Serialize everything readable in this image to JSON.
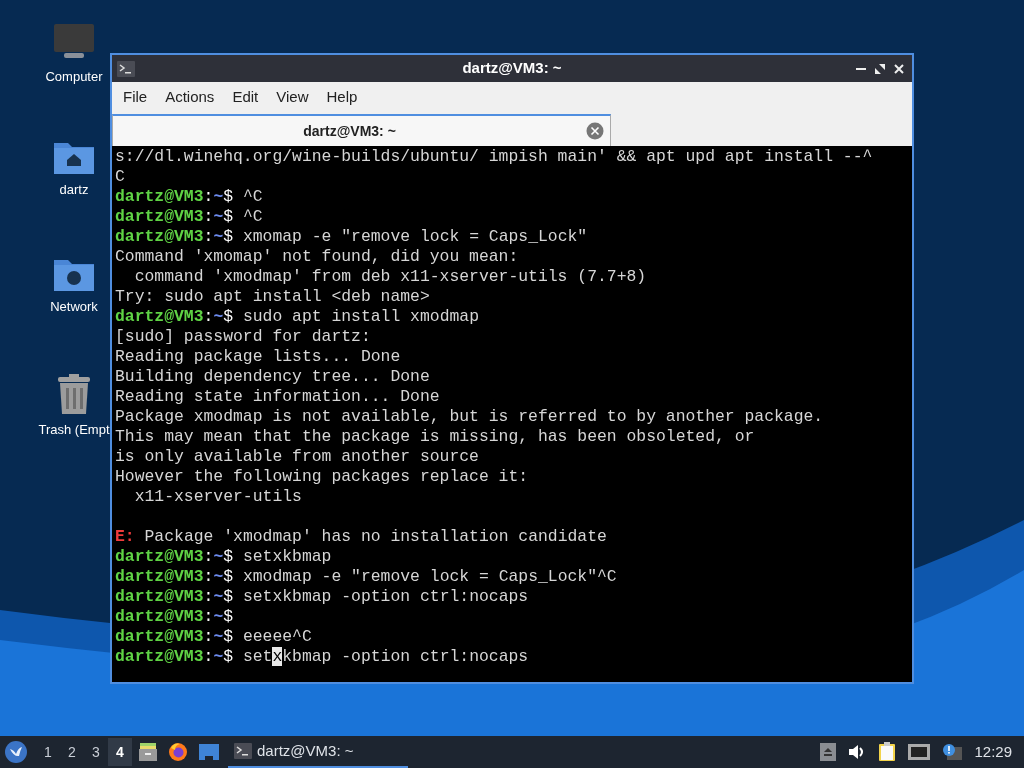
{
  "desktop_icons": [
    {
      "kind": "computer",
      "label": "Computer"
    },
    {
      "kind": "home",
      "label": "dartz"
    },
    {
      "kind": "network",
      "label": "Network"
    },
    {
      "kind": "trash",
      "label": "Trash (Empt"
    }
  ],
  "window": {
    "title": "dartz@VM3: ~",
    "menu": [
      "File",
      "Actions",
      "Edit",
      "View",
      "Help"
    ],
    "tabs": [
      {
        "label": "dartz@VM3: ~",
        "selected": true
      }
    ]
  },
  "terminal": {
    "lines": [
      {
        "kind": "text",
        "text": "s://dl.winehq.org/wine-builds/ubuntu/ impish main' && apt upd apt install --^"
      },
      {
        "kind": "text",
        "text": "C"
      },
      {
        "kind": "prompt",
        "user": "dartz@VM3",
        "sep": ":",
        "path": "~",
        "sigil": "$",
        "command": "^C"
      },
      {
        "kind": "prompt",
        "user": "dartz@VM3",
        "sep": ":",
        "path": "~",
        "sigil": "$",
        "command": "^C"
      },
      {
        "kind": "prompt",
        "user": "dartz@VM3",
        "sep": ":",
        "path": "~",
        "sigil": "$",
        "command": "xmomap -e \"remove lock = Caps_Lock\""
      },
      {
        "kind": "text",
        "text": "Command 'xmomap' not found, did you mean:"
      },
      {
        "kind": "text",
        "text": "  command 'xmodmap' from deb x11-xserver-utils (7.7+8)"
      },
      {
        "kind": "text",
        "text": "Try: sudo apt install <deb name>"
      },
      {
        "kind": "prompt",
        "user": "dartz@VM3",
        "sep": ":",
        "path": "~",
        "sigil": "$",
        "command": "sudo apt install xmodmap"
      },
      {
        "kind": "text",
        "text": "[sudo] password for dartz:"
      },
      {
        "kind": "text",
        "text": "Reading package lists... Done"
      },
      {
        "kind": "text",
        "text": "Building dependency tree... Done"
      },
      {
        "kind": "text",
        "text": "Reading state information... Done"
      },
      {
        "kind": "text",
        "text": "Package xmodmap is not available, but is referred to by another package."
      },
      {
        "kind": "text",
        "text": "This may mean that the package is missing, has been obsoleted, or"
      },
      {
        "kind": "text",
        "text": "is only available from another source"
      },
      {
        "kind": "text",
        "text": "However the following packages replace it:"
      },
      {
        "kind": "text",
        "text": "  x11-xserver-utils"
      },
      {
        "kind": "blank"
      },
      {
        "kind": "error",
        "tag": "E:",
        "text": "Package 'xmodmap' has no installation candidate"
      },
      {
        "kind": "prompt",
        "user": "dartz@VM3",
        "sep": ":",
        "path": "~",
        "sigil": "$",
        "command": "setxkbmap"
      },
      {
        "kind": "prompt",
        "user": "dartz@VM3",
        "sep": ":",
        "path": "~",
        "sigil": "$",
        "command": "xmodmap -e \"remove lock = Caps_Lock\"^C"
      },
      {
        "kind": "prompt",
        "user": "dartz@VM3",
        "sep": ":",
        "path": "~",
        "sigil": "$",
        "command": "setxkbmap -option ctrl:nocaps"
      },
      {
        "kind": "prompt",
        "user": "dartz@VM3",
        "sep": ":",
        "path": "~",
        "sigil": "$"
      },
      {
        "kind": "prompt",
        "user": "dartz@VM3",
        "sep": ":",
        "path": "~",
        "sigil": "$",
        "command": "eeeee^C"
      },
      {
        "kind": "cursor",
        "user": "dartz@VM3",
        "sep": ":",
        "path": "~",
        "sigil": "$",
        "before": "set",
        "at": "x",
        "after": "kbmap -option ctrl:nocaps"
      }
    ]
  },
  "taskbar": {
    "workspaces": [
      {
        "label": "1",
        "selected": false
      },
      {
        "label": "2",
        "selected": false
      },
      {
        "label": "3",
        "selected": false
      },
      {
        "label": "4",
        "selected": true
      }
    ],
    "launchers": [
      {
        "kind": "files"
      },
      {
        "kind": "browser"
      },
      {
        "kind": "desktop"
      }
    ],
    "tasks": [
      {
        "label": "dartz@VM3: ~",
        "selected": true
      }
    ],
    "clock": "12:29"
  }
}
